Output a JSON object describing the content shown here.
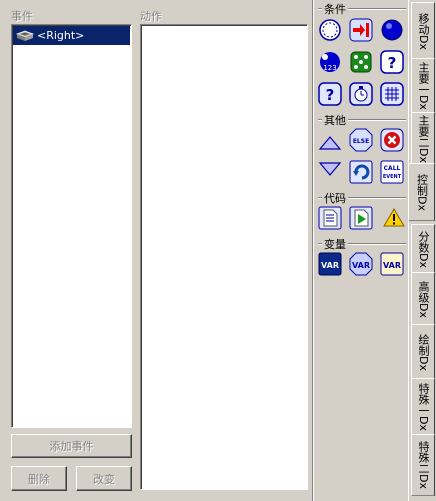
{
  "events_panel": {
    "header": "事件",
    "items": [
      {
        "label": "<Right>"
      }
    ]
  },
  "actions_panel": {
    "header": "动作"
  },
  "buttons": {
    "add_event": "添加事件",
    "delete": "删除",
    "change": "改变"
  },
  "palette": {
    "sections": {
      "conditions": "条件",
      "other": "其他",
      "code": "代码",
      "variables": "变量"
    },
    "icon_texts": {
      "else": "ELSE",
      "call_event_1": "CALL",
      "call_event_2": "EVENT",
      "var": "VAR"
    }
  },
  "tabs": [
    "移动Dx",
    "主要一Dx",
    "主要二Dx",
    "控制Dx",
    "分数Dx",
    "高级Dx",
    "绘制Dx",
    "特殊一Dx",
    "特殊二Dx"
  ],
  "colors": {
    "selection": "#0a246a",
    "accent_blue": "#0000cc"
  }
}
